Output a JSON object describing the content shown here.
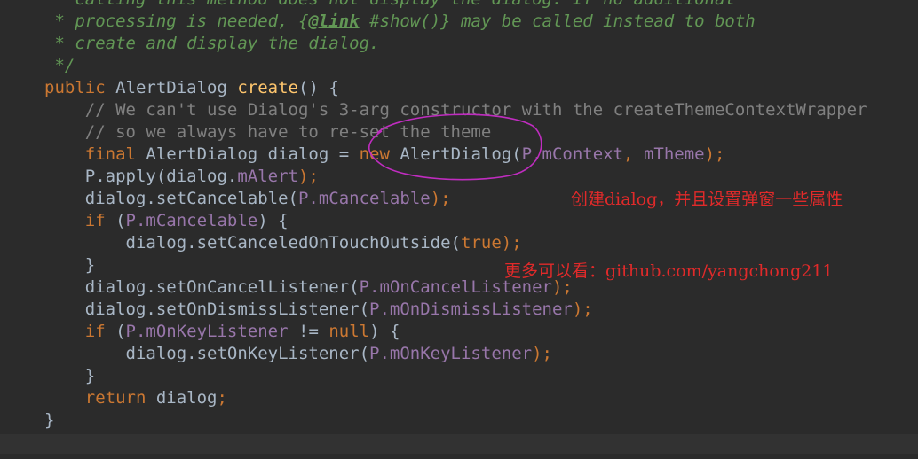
{
  "editor": {
    "lines": [
      [
        {
          "t": " * calling this method does not display the dialog. If no additional",
          "c": "c-doc"
        }
      ],
      [
        {
          "t": " * processing is needed, {",
          "c": "c-doc"
        },
        {
          "t": "@link",
          "c": "c-doctag"
        },
        {
          "t": " #show()} may be called instead to both",
          "c": "c-doc"
        }
      ],
      [
        {
          "t": " * create and display the dialog.",
          "c": "c-doc"
        }
      ],
      [
        {
          "t": " */",
          "c": "c-doc"
        }
      ],
      [
        {
          "t": "public ",
          "c": "kw"
        },
        {
          "t": "AlertDialog ",
          "c": "pl"
        },
        {
          "t": "create",
          "c": "fn"
        },
        {
          "t": "() {",
          "c": "pl"
        }
      ],
      [
        {
          "t": "    // We can't use Dialog's 3-arg constructor with the createThemeContextWrapper",
          "c": "c-cmt"
        }
      ],
      [
        {
          "t": "    // so we always have to re-set the theme",
          "c": "c-cmt"
        }
      ],
      [
        {
          "t": "    final ",
          "c": "kw"
        },
        {
          "t": "AlertDialog dialog = ",
          "c": "pl"
        },
        {
          "t": "new ",
          "c": "kw"
        },
        {
          "t": "AlertDialog(",
          "c": "pl"
        },
        {
          "t": "P.mContext",
          "c": "fld"
        },
        {
          "t": ", ",
          "c": "kw"
        },
        {
          "t": "mTheme",
          "c": "fld"
        },
        {
          "t": ");",
          "c": "kw"
        }
      ],
      [
        {
          "t": "    P.apply(dialog.",
          "c": "pl"
        },
        {
          "t": "mAlert",
          "c": "fld"
        },
        {
          "t": ");",
          "c": "kw"
        }
      ],
      [
        {
          "t": "    dialog.setCancelable(",
          "c": "pl"
        },
        {
          "t": "P.mCancelable",
          "c": "fld"
        },
        {
          "t": ");",
          "c": "kw"
        }
      ],
      [
        {
          "t": "    if ",
          "c": "kw"
        },
        {
          "t": "(",
          "c": "pl"
        },
        {
          "t": "P.mCancelable",
          "c": "fld"
        },
        {
          "t": ") {",
          "c": "pl"
        }
      ],
      [
        {
          "t": "        dialog.setCanceledOnTouchOutside(",
          "c": "pl"
        },
        {
          "t": "true",
          "c": "kw"
        },
        {
          "t": ");",
          "c": "kw"
        }
      ],
      [
        {
          "t": "    }",
          "c": "pl"
        }
      ],
      [
        {
          "t": "    dialog.setOnCancelListener(",
          "c": "pl"
        },
        {
          "t": "P.mOnCancelListener",
          "c": "fld"
        },
        {
          "t": ");",
          "c": "kw"
        }
      ],
      [
        {
          "t": "    dialog.setOnDismissListener(",
          "c": "pl"
        },
        {
          "t": "P.mOnDismissListener",
          "c": "fld"
        },
        {
          "t": ");",
          "c": "kw"
        }
      ],
      [
        {
          "t": "    if ",
          "c": "kw"
        },
        {
          "t": "(",
          "c": "pl"
        },
        {
          "t": "P.mOnKeyListener",
          "c": "fld"
        },
        {
          "t": " != ",
          "c": "pl"
        },
        {
          "t": "null",
          "c": "kw"
        },
        {
          "t": ") {",
          "c": "pl"
        }
      ],
      [
        {
          "t": "        dialog.setOnKeyListener(",
          "c": "pl"
        },
        {
          "t": "P.mOnKeyListener",
          "c": "fld"
        },
        {
          "t": ");",
          "c": "kw"
        }
      ],
      [
        {
          "t": "    }",
          "c": "pl"
        }
      ],
      [
        {
          "t": "    return ",
          "c": "kw"
        },
        {
          "t": "dialog",
          "c": "pl"
        },
        {
          "t": ";",
          "c": "kw"
        }
      ],
      [
        {
          "t": "}",
          "c": "pl"
        }
      ]
    ]
  },
  "annotations": {
    "note1": "创建dialog，并且设置弹窗一些属性",
    "note2": "更多可以看：github.com/yangchong211",
    "color": "#e02a2a",
    "ellipse_color": "#c02cc0"
  }
}
